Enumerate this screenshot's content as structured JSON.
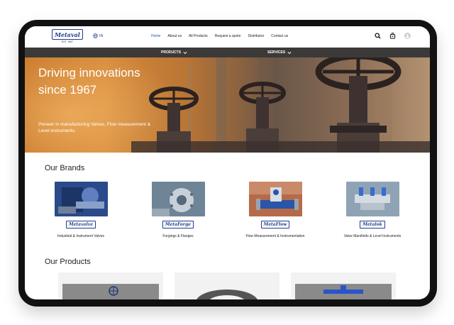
{
  "header": {
    "logo_text": "Metaval",
    "logo_est": "EST. 1967",
    "lang_label": "IN",
    "nav": [
      "Home",
      "About us",
      "All Products",
      "Request a quote",
      "Distributor",
      "Contact us"
    ],
    "icons": [
      "search-icon",
      "cart-icon",
      "user-icon"
    ]
  },
  "subbar": {
    "products": "PRODUCTS",
    "services": "SERVICES"
  },
  "hero": {
    "title": "Driving innovations since 1967",
    "subtitle": "Pioneer in manufacturing Valves, Flow measurement & Level instruments."
  },
  "brands": {
    "title": "Our Brands",
    "items": [
      {
        "badge": "Metavalve",
        "caption": "Industrial & Instrument Valves"
      },
      {
        "badge": "MetaForge",
        "caption": "Forgings & Flanges"
      },
      {
        "badge": "MetaFlow",
        "caption": "Flow Measurement & Instrumentation"
      },
      {
        "badge": "Metalok",
        "caption": "Valve Manifolds & Level Instruments"
      }
    ]
  },
  "products": {
    "title": "Our Products"
  },
  "colors": {
    "brand": "#1f3c8a",
    "nav_active": "#2a4db8",
    "subbar": "#3b3a38",
    "hero_orange": "#d68a3a"
  }
}
